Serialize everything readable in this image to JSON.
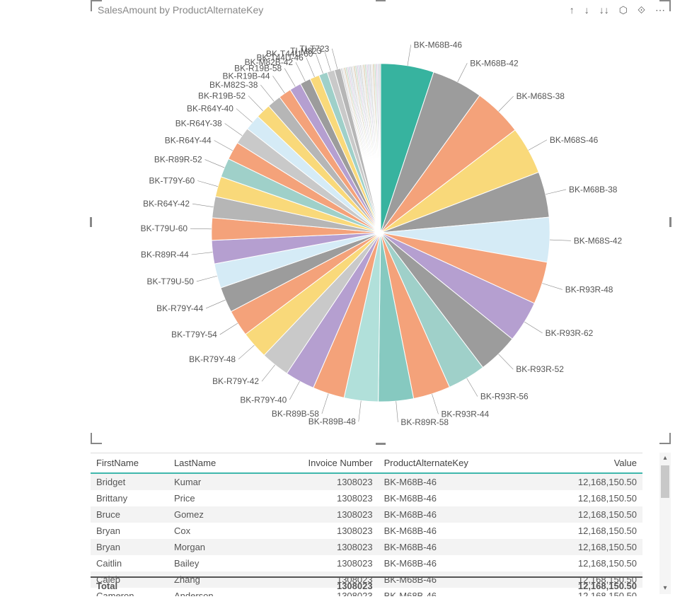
{
  "chart_data": {
    "type": "pie",
    "title": "SalesAmount by ProductAlternateKey",
    "slices": [
      {
        "label": "BK-M68B-46",
        "value": 5.0,
        "color": "#37b39f"
      },
      {
        "label": "BK-M68B-42",
        "value": 4.8,
        "color": "#9c9c9c"
      },
      {
        "label": "BK-M68S-38",
        "value": 4.6,
        "color": "#f4a27a"
      },
      {
        "label": "BK-M68S-46",
        "value": 4.5,
        "color": "#f9d97a"
      },
      {
        "label": "BK-M68B-38",
        "value": 4.3,
        "color": "#9c9c9c"
      },
      {
        "label": "BK-M68S-42",
        "value": 4.2,
        "color": "#d5ebf6"
      },
      {
        "label": "BK-R93R-48",
        "value": 4.0,
        "color": "#f4a27a"
      },
      {
        "label": "BK-R93R-62",
        "value": 3.9,
        "color": "#b59fd0"
      },
      {
        "label": "BK-R93R-52",
        "value": 3.8,
        "color": "#9c9c9c"
      },
      {
        "label": "BK-R93R-56",
        "value": 3.6,
        "color": "#9fd0c9"
      },
      {
        "label": "BK-R93R-44",
        "value": 3.5,
        "color": "#f4a27a"
      },
      {
        "label": "BK-R89R-58",
        "value": 3.3,
        "color": "#86c9c0"
      },
      {
        "label": "BK-R89B-48",
        "value": 3.2,
        "color": "#b1e0da"
      },
      {
        "label": "BK-R89B-58",
        "value": 3.0,
        "color": "#f4a27a"
      },
      {
        "label": "BK-R79Y-40",
        "value": 2.8,
        "color": "#b59fd0"
      },
      {
        "label": "BK-R79Y-42",
        "value": 2.7,
        "color": "#c9c9c9"
      },
      {
        "label": "BK-R79Y-48",
        "value": 2.6,
        "color": "#f9d97a"
      },
      {
        "label": "BK-T79Y-54",
        "value": 2.5,
        "color": "#f4a27a"
      },
      {
        "label": "BK-R79Y-44",
        "value": 2.4,
        "color": "#9c9c9c"
      },
      {
        "label": "BK-T79U-50",
        "value": 2.3,
        "color": "#d5ebf6"
      },
      {
        "label": "BK-R89R-44",
        "value": 2.2,
        "color": "#b59fd0"
      },
      {
        "label": "BK-T79U-60",
        "value": 2.1,
        "color": "#f4a27a"
      },
      {
        "label": "BK-R64Y-42",
        "value": 2.0,
        "color": "#b6b6b6"
      },
      {
        "label": "BK-T79Y-60",
        "value": 1.9,
        "color": "#f9d97a"
      },
      {
        "label": "BK-R89R-52",
        "value": 1.8,
        "color": "#9fd0c9"
      },
      {
        "label": "BK-R64Y-44",
        "value": 1.7,
        "color": "#f4a27a"
      },
      {
        "label": "BK-R64Y-38",
        "value": 1.6,
        "color": "#c9c9c9"
      },
      {
        "label": "BK-R64Y-40",
        "value": 1.5,
        "color": "#d5ebf6"
      },
      {
        "label": "BK-R19B-52",
        "value": 1.4,
        "color": "#f9d97a"
      },
      {
        "label": "BK-M82S-38",
        "value": 1.3,
        "color": "#b6b6b6"
      },
      {
        "label": "BK-R19B-44",
        "value": 1.2,
        "color": "#f4a27a"
      },
      {
        "label": "BK-R19B-58",
        "value": 1.1,
        "color": "#b59fd0"
      },
      {
        "label": "BK-M82B-42",
        "value": 1.0,
        "color": "#9c9c9c"
      },
      {
        "label": "BK-T44U-46",
        "value": 0.9,
        "color": "#f9d97a"
      },
      {
        "label": "BK-T44U-60",
        "value": 0.8,
        "color": "#9fd0c9"
      },
      {
        "label": "TI-M823",
        "value": 0.7,
        "color": "#c9c9c9"
      },
      {
        "label": "TI-T723",
        "value": 0.6,
        "color": "#b6b6b6"
      }
    ],
    "other_slices_count": 25
  },
  "toolbar": {
    "drill_up": "↑",
    "drill_down": "↓",
    "expand": "↓↓",
    "hierarchy": "⬡",
    "focus": "⟐",
    "more": "⋯"
  },
  "table": {
    "columns": [
      "FirstName",
      "LastName",
      "Invoice Number",
      "ProductAlternateKey",
      "Value"
    ],
    "rows": [
      {
        "FirstName": "Bridget",
        "LastName": "Kumar",
        "Invoice": "1308023",
        "PAK": "BK-M68B-46",
        "Value": "12,168,150.50"
      },
      {
        "FirstName": "Brittany",
        "LastName": "Price",
        "Invoice": "1308023",
        "PAK": "BK-M68B-46",
        "Value": "12,168,150.50"
      },
      {
        "FirstName": "Bruce",
        "LastName": "Gomez",
        "Invoice": "1308023",
        "PAK": "BK-M68B-46",
        "Value": "12,168,150.50"
      },
      {
        "FirstName": "Bryan",
        "LastName": "Cox",
        "Invoice": "1308023",
        "PAK": "BK-M68B-46",
        "Value": "12,168,150.50"
      },
      {
        "FirstName": "Bryan",
        "LastName": "Morgan",
        "Invoice": "1308023",
        "PAK": "BK-M68B-46",
        "Value": "12,168,150.50"
      },
      {
        "FirstName": "Caitlin",
        "LastName": "Bailey",
        "Invoice": "1308023",
        "PAK": "BK-M68B-46",
        "Value": "12,168,150.50"
      },
      {
        "FirstName": "Caleb",
        "LastName": "Zhang",
        "Invoice": "1308023",
        "PAK": "BK-M68B-46",
        "Value": "12,168,150.50"
      },
      {
        "FirstName": "Cameron",
        "LastName": "Anderson",
        "Invoice": "1308023",
        "PAK": "BK-M68B-46",
        "Value": "12,168,150.50"
      }
    ],
    "total": {
      "label": "Total",
      "Invoice": "1308023",
      "Value": "12,168,150.50"
    }
  }
}
